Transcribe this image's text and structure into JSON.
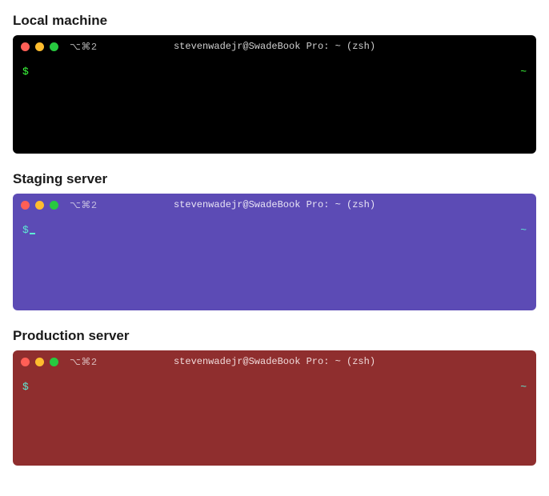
{
  "terminals": [
    {
      "label": "Local machine",
      "variant": "local",
      "shortcut": "⌥⌘2",
      "title": "stevenwadejr@SwadeBook Pro: ~ (zsh)",
      "prompt": "$",
      "tilde": "~",
      "show_cursor": false
    },
    {
      "label": "Staging server",
      "variant": "staging",
      "shortcut": "⌥⌘2",
      "title": "stevenwadejr@SwadeBook Pro: ~ (zsh)",
      "prompt": "$",
      "tilde": "~",
      "show_cursor": true
    },
    {
      "label": "Production server",
      "variant": "production",
      "shortcut": "⌥⌘2",
      "title": "stevenwadejr@SwadeBook Pro: ~ (zsh)",
      "prompt": "$",
      "tilde": "~",
      "show_cursor": false
    }
  ]
}
